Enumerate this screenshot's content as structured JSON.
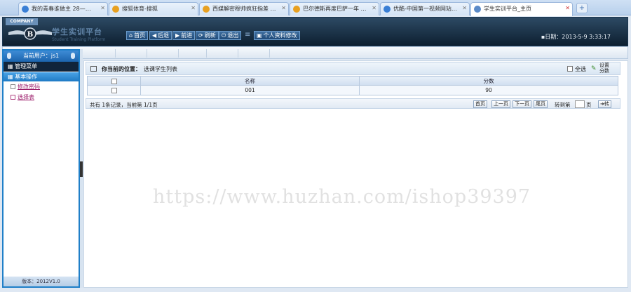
{
  "browser": {
    "tabs": [
      {
        "label": "我的青春谁做主 28—…"
      },
      {
        "label": "搜狐体育-搜狐"
      },
      {
        "label": "西媒解密穆帅疯狂指差 …"
      },
      {
        "label": "巴尔德斯再度巴萨一年 …"
      },
      {
        "label": "优酷-中国第一视频网站…"
      },
      {
        "label": "学生实训平台_主页"
      }
    ],
    "new_tab": "+"
  },
  "header": {
    "company": "COMPANY",
    "brand": "学生实训平台",
    "brand_sub": "Student Training Platform",
    "nav": [
      {
        "icon": "⌂",
        "label": "首页"
      },
      {
        "icon": "◀",
        "label": "后退"
      },
      {
        "icon": "▶",
        "label": "前进"
      },
      {
        "icon": "⟳",
        "label": "刷新"
      },
      {
        "icon": "⏻",
        "label": "退出"
      }
    ],
    "separator": "≡",
    "profile_button": "个人资料修改",
    "date_label": "日期：",
    "date_value": "2013-5-9 3:33:17"
  },
  "sidebar": {
    "current_user": "当前用户：js1",
    "menu_header": "管理菜单",
    "system_ops": "基本操作",
    "links": [
      {
        "label": "修改密码"
      },
      {
        "label": "选择表"
      }
    ],
    "version": "版本：2012V1.0"
  },
  "main": {
    "location_label": "你当前的位置：",
    "location_value": "选课学生列表",
    "select_all": "全选",
    "set_score": "设置分数",
    "table": {
      "headers": [
        "",
        "名称",
        "分数"
      ],
      "rows": [
        {
          "name": "001",
          "score": "90"
        }
      ]
    },
    "pager": {
      "summary": "共有 1条记录，当前第 1/1页",
      "first": "首页",
      "prev": "上一页",
      "next": "下一页",
      "last": "尾页",
      "jump_label": "转到第",
      "page_unit": "页",
      "go": "➜转"
    }
  },
  "watermark": "https://www.huzhan.com/ishop39397"
}
